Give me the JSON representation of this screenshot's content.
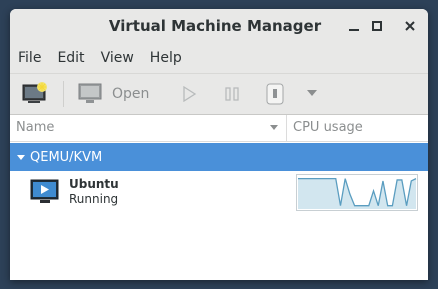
{
  "window": {
    "title": "Virtual Machine Manager"
  },
  "menu": [
    "File",
    "Edit",
    "View",
    "Help"
  ],
  "toolbar": {
    "open_label": "Open"
  },
  "columns": {
    "name": "Name",
    "cpu": "CPU usage"
  },
  "group": {
    "label": "QEMU/KVM"
  },
  "vm": {
    "name": "Ubuntu",
    "status": "Running",
    "cpu_usage": [
      0.92,
      0.92,
      0.92,
      0.92,
      0.92,
      0.92,
      0.92,
      0.92,
      0.92,
      0.1,
      0.92,
      0.45,
      0.1,
      0.1,
      0.1,
      0.1,
      0.55,
      0.1,
      0.85,
      0.1,
      0.1,
      0.88,
      0.88,
      0.1,
      0.85,
      0.92
    ]
  },
  "colors": {
    "selection": "#4a90d9",
    "graph_line": "#5a9dc0",
    "graph_fill": "#d2e6ef"
  }
}
